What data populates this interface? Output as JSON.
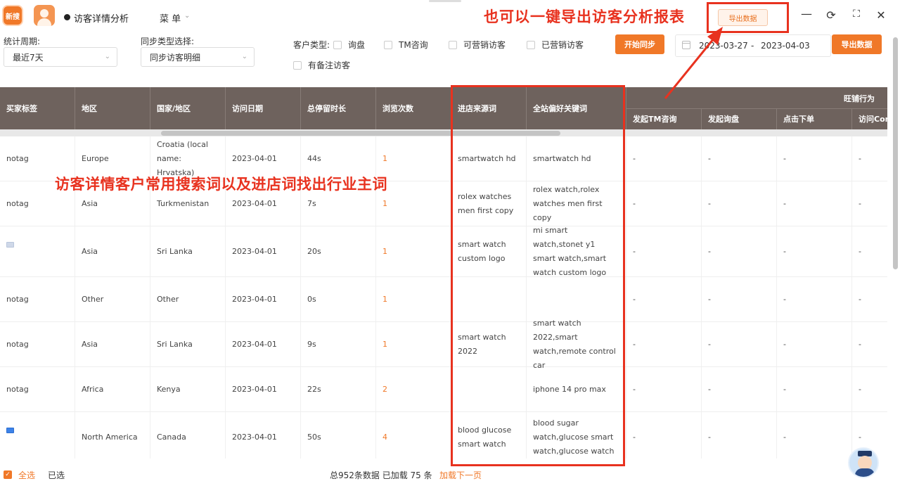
{
  "titlebar": {
    "logo_text": "新搜",
    "tab_title": "访客详情分析",
    "menu_label": "菜 单",
    "export_label": "导出数据",
    "controls": [
      "minimize-icon",
      "refresh-icon",
      "fullscreen-icon",
      "close-icon"
    ]
  },
  "annotations": {
    "top_text": "也可以一键导出访客分析报表",
    "middle_text": "访客详情客户常用搜索词以及进店词找出行业主词",
    "color": "#e8321f"
  },
  "filters": {
    "period_label": "统计周期:",
    "period_value": "最近7天",
    "sync_type_label": "同步类型选择:",
    "sync_type_value": "同步访客明细",
    "customer_type_label": "客户类型:",
    "checkboxes": [
      "询盘",
      "TM咨询",
      "可营销访客",
      "已营销访客",
      "有备注访客"
    ],
    "sync_button": "开始同步",
    "date_start": "2023-03-27",
    "date_sep": "-",
    "date_end": "2023-04-03",
    "export_button": "导出数据"
  },
  "table": {
    "group_header": "旺铺行为",
    "columns": [
      "买家标签",
      "地区",
      "国家/地区",
      "访问日期",
      "总停留时长",
      "浏览次数",
      "进店来源词",
      "全站偏好关键词"
    ],
    "sub_columns": [
      "发起TM咨询",
      "发起询盘",
      "点击下单",
      "访问Con"
    ],
    "rows": [
      {
        "tag": "notag",
        "region": "Europe",
        "country": "Croatia (local name: Hrvatska)",
        "date": "2023-04-01",
        "duration": "44s",
        "views": "1",
        "source_kw": "smartwatch hd",
        "pref_kw": "smartwatch hd",
        "tm": "-",
        "inquiry": "-",
        "order": "-",
        "visit": "-"
      },
      {
        "tag": "notag",
        "region": "Asia",
        "country": "Turkmenistan",
        "date": "2023-04-01",
        "duration": "7s",
        "views": "1",
        "source_kw": "rolex watches men first copy",
        "pref_kw": "rolex watch,rolex watches men first copy",
        "tm": "-",
        "inquiry": "-",
        "order": "-",
        "visit": "-"
      },
      {
        "tag": "",
        "region": "Asia",
        "country": "Sri Lanka",
        "date": "2023-04-01",
        "duration": "20s",
        "views": "1",
        "source_kw": "smart watch custom logo",
        "pref_kw": "mi smart watch,stonet y1 smart watch,smart watch custom logo",
        "tm": "-",
        "inquiry": "-",
        "order": "-",
        "visit": "-"
      },
      {
        "tag": "notag",
        "region": "Other",
        "country": "Other",
        "date": "2023-04-01",
        "duration": "0s",
        "views": "1",
        "source_kw": "",
        "pref_kw": "",
        "tm": "-",
        "inquiry": "-",
        "order": "-",
        "visit": "-"
      },
      {
        "tag": "notag",
        "region": "Asia",
        "country": "Sri Lanka",
        "date": "2023-04-01",
        "duration": "9s",
        "views": "1",
        "source_kw": "smart watch 2022",
        "pref_kw": "smart watch 2022,smart watch,remote control car",
        "tm": "-",
        "inquiry": "-",
        "order": "-",
        "visit": "-"
      },
      {
        "tag": "notag",
        "region": "Africa",
        "country": "Kenya",
        "date": "2023-04-01",
        "duration": "22s",
        "views": "2",
        "source_kw": "",
        "pref_kw": "iphone 14 pro max",
        "tm": "-",
        "inquiry": "-",
        "order": "-",
        "visit": "-"
      },
      {
        "tag": "",
        "region": "North America",
        "country": "Canada",
        "date": "2023-04-01",
        "duration": "50s",
        "views": "4",
        "source_kw": "blood glucose smart watch",
        "pref_kw": "blood sugar watch,glucose smart watch,glucose watch",
        "tm": "-",
        "inquiry": "-",
        "order": "-",
        "visit": "-"
      }
    ]
  },
  "footer": {
    "select_all": "全选",
    "selected": "已选",
    "summary": "总952条数据 已加载 75 条",
    "load_next": "加载下一页"
  }
}
